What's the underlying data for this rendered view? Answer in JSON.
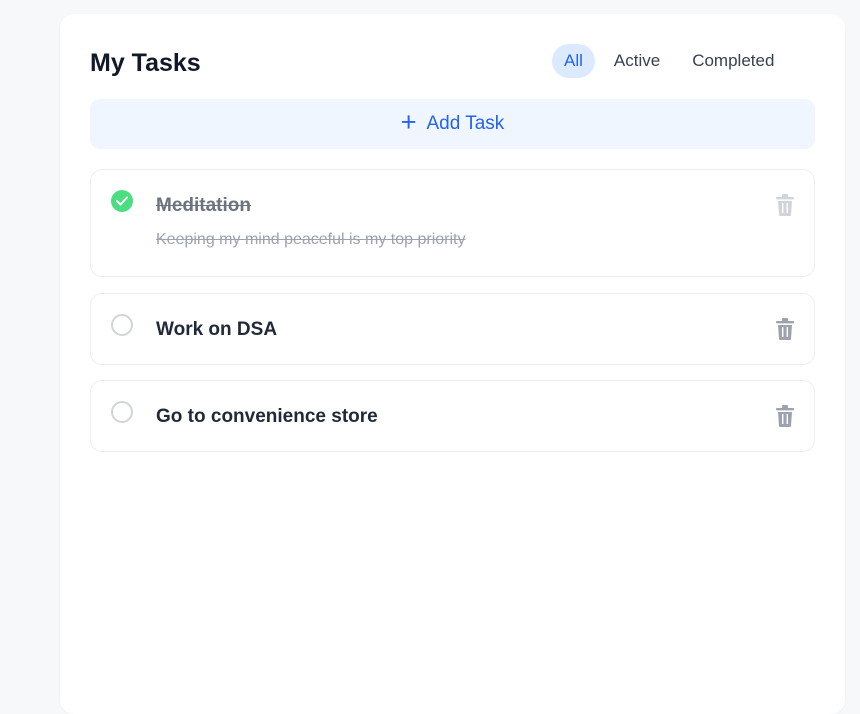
{
  "header": {
    "title": "My Tasks"
  },
  "filters": {
    "all": "All",
    "active": "Active",
    "completed": "Completed",
    "selected": "All"
  },
  "add_button": {
    "label": "Add Task"
  },
  "tasks": [
    {
      "title": "Meditation",
      "description": "Keeping my mind peaceful is my top priority",
      "completed": true
    },
    {
      "title": "Work on DSA",
      "completed": false
    },
    {
      "title": "Go to convenience store",
      "completed": false
    }
  ],
  "colors": {
    "accent": "#2563eb",
    "accent_bg": "#eff6ff",
    "done_green": "#4ade80"
  }
}
